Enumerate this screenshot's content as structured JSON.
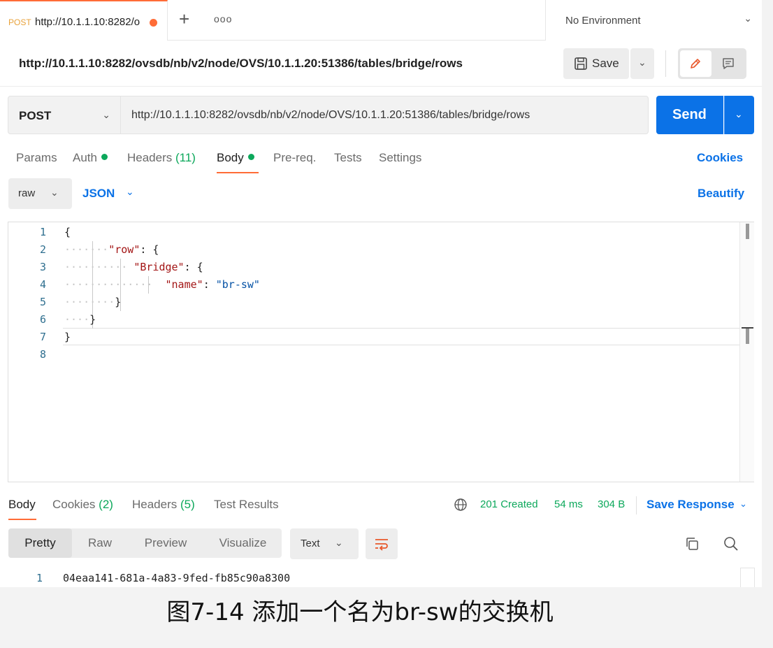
{
  "tab": {
    "method": "POST",
    "url": "http://10.1.1.10:8282/o",
    "plus": "+",
    "more": "ooo"
  },
  "environment": {
    "label": "No Environment"
  },
  "title": {
    "url": "http://10.1.1.10:8282/ovsdb/nb/v2/node/OVS/10.1.1.20:51386/tables/bridge/rows"
  },
  "toolbar": {
    "save_label": "Save"
  },
  "request": {
    "method": "POST",
    "url": "http://10.1.1.10:8282/ovsdb/nb/v2/node/OVS/10.1.1.20:51386/tables/bridge/rows",
    "send_label": "Send"
  },
  "request_tabs": {
    "params": "Params",
    "auth": "Auth",
    "headers": "Headers",
    "headers_count": "(11)",
    "body": "Body",
    "prereq": "Pre-req.",
    "tests": "Tests",
    "settings": "Settings",
    "cookies": "Cookies"
  },
  "body_options": {
    "mode": "raw",
    "language": "JSON",
    "beautify": "Beautify"
  },
  "editor": {
    "line_numbers": [
      "1",
      "2",
      "3",
      "4",
      "5",
      "6",
      "7",
      "8"
    ],
    "key_row": "\"row\"",
    "key_bridge": "\"Bridge\"",
    "key_name": "\"name\"",
    "val_name": "\"br-sw\""
  },
  "response": {
    "tabs": {
      "body": "Body",
      "cookies": "Cookies",
      "cookies_count": "(2)",
      "headers": "Headers",
      "headers_count": "(5)",
      "test_results": "Test Results"
    },
    "status": "201 Created",
    "time": "54 ms",
    "size": "304 B",
    "save_response": "Save Response",
    "views": [
      "Pretty",
      "Raw",
      "Preview",
      "Visualize"
    ],
    "format": "Text",
    "line_no": "1",
    "line": "04eaa141-681a-4a83-9fed-fb85c90a8300"
  },
  "caption": "图7-14 添加一个名为br-sw的交换机",
  "colors": {
    "accent": "#ff6c37",
    "primary": "#0b72e7",
    "success": "#0ca85b"
  }
}
